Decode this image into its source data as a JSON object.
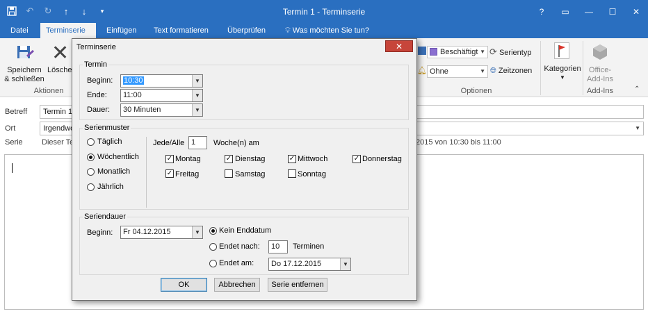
{
  "window": {
    "title": "Termin 1 - Terminserie",
    "controls": [
      "?",
      "▭",
      "—",
      "☐",
      "✕"
    ]
  },
  "tabs": [
    "Datei",
    "Terminserie",
    "Einfügen",
    "Text formatieren",
    "Überprüfen",
    "Was möchten Sie tun?"
  ],
  "ribbon": {
    "save_label_1": "Speichern",
    "save_label_2": "& schließen",
    "delete_label": "Lösche",
    "group_actions": "Aktionen",
    "busy_value": "Beschäftigt",
    "series_type_label": "Serientyp",
    "reminder_value": "Ohne",
    "time_zones_label": "Zeitzonen",
    "group_options": "Optionen",
    "categories_label": "Kategorien",
    "office_addins_1": "Office-",
    "office_addins_2": "Add-Ins",
    "group_addins": "Add-Ins",
    "busy_color": "#8a6fd0"
  },
  "form": {
    "subject_label": "Betreff",
    "subject_value": "Termin 1",
    "location_label": "Ort",
    "location_value": "Irgendwo",
    "series_label": "Serie",
    "series_value_left": "Dieser Te",
    "series_value_right": "2015 von 10:30 bis 11:00"
  },
  "dialog": {
    "title": "Terminserie",
    "close_glyph": "✕",
    "termin": {
      "group": "Termin",
      "begin_label": "Beginn:",
      "begin_value": "10:30",
      "end_label": "Ende:",
      "end_value": "11:00",
      "duration_label": "Dauer:",
      "duration_value": "30 Minuten"
    },
    "pattern": {
      "group": "Serienmuster",
      "options": [
        "Täglich",
        "Wöchentlich",
        "Monatlich",
        "Jährlich"
      ],
      "selected": "Wöchentlich",
      "every_label": "Jede/Alle",
      "every_value": "1",
      "weeks_label": "Woche(n) am",
      "days": [
        {
          "name": "Montag",
          "checked": true
        },
        {
          "name": "Dienstag",
          "checked": true
        },
        {
          "name": "Mittwoch",
          "checked": true
        },
        {
          "name": "Donnerstag",
          "checked": true
        },
        {
          "name": "Freitag",
          "checked": true
        },
        {
          "name": "Samstag",
          "checked": false
        },
        {
          "name": "Sonntag",
          "checked": false
        }
      ]
    },
    "duration": {
      "group": "Seriendauer",
      "begin_label": "Beginn:",
      "begin_value": "Fr 04.12.2015",
      "no_end": "Kein Enddatum",
      "end_after": "Endet nach:",
      "end_after_value": "10",
      "end_after_unit": "Terminen",
      "end_on": "Endet am:",
      "end_on_value": "Do 17.12.2015",
      "selected": "Kein Enddatum"
    },
    "buttons": {
      "ok": "OK",
      "cancel": "Abbrechen",
      "remove": "Serie entfernen"
    }
  }
}
